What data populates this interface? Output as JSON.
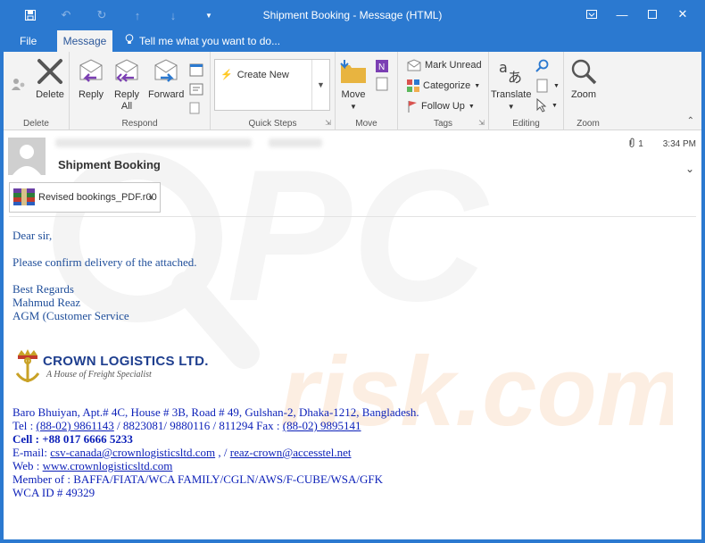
{
  "window": {
    "title": "Shipment Booking - Message (HTML)",
    "qat_icons": [
      "save-icon",
      "undo-icon",
      "redo-icon",
      "up-arrow-icon",
      "down-arrow-icon",
      "customize-icon"
    ],
    "controls": [
      "ribbon-display-icon",
      "minimize-icon",
      "maximize-icon",
      "close-icon"
    ]
  },
  "tabs": {
    "file": "File",
    "message": "Message",
    "tell": "Tell me what you want to do..."
  },
  "ribbon": {
    "delete": {
      "button": "Delete",
      "group": "Delete"
    },
    "respond": {
      "reply": "Reply",
      "reply_all_1": "Reply",
      "reply_all_2": "All",
      "forward": "Forward",
      "group": "Respond"
    },
    "quick_steps": {
      "create_new": "Create New",
      "group": "Quick Steps"
    },
    "move": {
      "button": "Move",
      "group": "Move"
    },
    "tags": {
      "mark_unread": "Mark Unread",
      "categorize": "Categorize",
      "follow_up": "Follow Up",
      "group": "Tags"
    },
    "editing": {
      "translate": "Translate",
      "group": "Editing"
    },
    "zoom": {
      "button": "Zoom",
      "group": "Zoom"
    }
  },
  "message": {
    "subject": "Shipment Booking",
    "attachment_count": "1",
    "time": "3:34 PM",
    "attachment_name": "Revised bookings_PDF.r00"
  },
  "body": {
    "greeting": "Dear sir,",
    "line1": "Please confirm delivery of the attached.",
    "regards": "Best Regards",
    "name": "Mahmud Reaz",
    "role": "AGM (Customer Service"
  },
  "logo": {
    "company": "CROWN LOGISTICS LTD.",
    "tagline": "A House of Freight Specialist"
  },
  "signature": {
    "address": "Baro Bhuiyan, Apt.# 4C, House # 3B, Road # 49, Gulshan-2, Dhaka-1212, Bangladesh.",
    "tel_label": "Tel : ",
    "tel_link": "(88-02) 9861143",
    "tel_rest": " / 8823081/ 9880116 / 811294 Fax : ",
    "fax_link": "(88-02) 9895141",
    "cell": "Cell : +88 017 6666 5233",
    "email_label": "E-mail: ",
    "email1": "csv-canada@crownlogisticsltd.com",
    "email_sep": " , / ",
    "email2": "reaz-crown@accesstel.net",
    "web_label": "Web : ",
    "web": "www.crownlogisticsltd.com",
    "member": "Member of : BAFFA/FIATA/WCA FAMILY/CGLN/AWS/F-CUBE/WSA/GFK",
    "wca": "WCA ID # 49329"
  },
  "colors": {
    "titlebar": "#2b79d0",
    "ribbon": "#f3f3f3",
    "body_text": "#1f4e9a",
    "signature_text": "#0b1fb8"
  }
}
